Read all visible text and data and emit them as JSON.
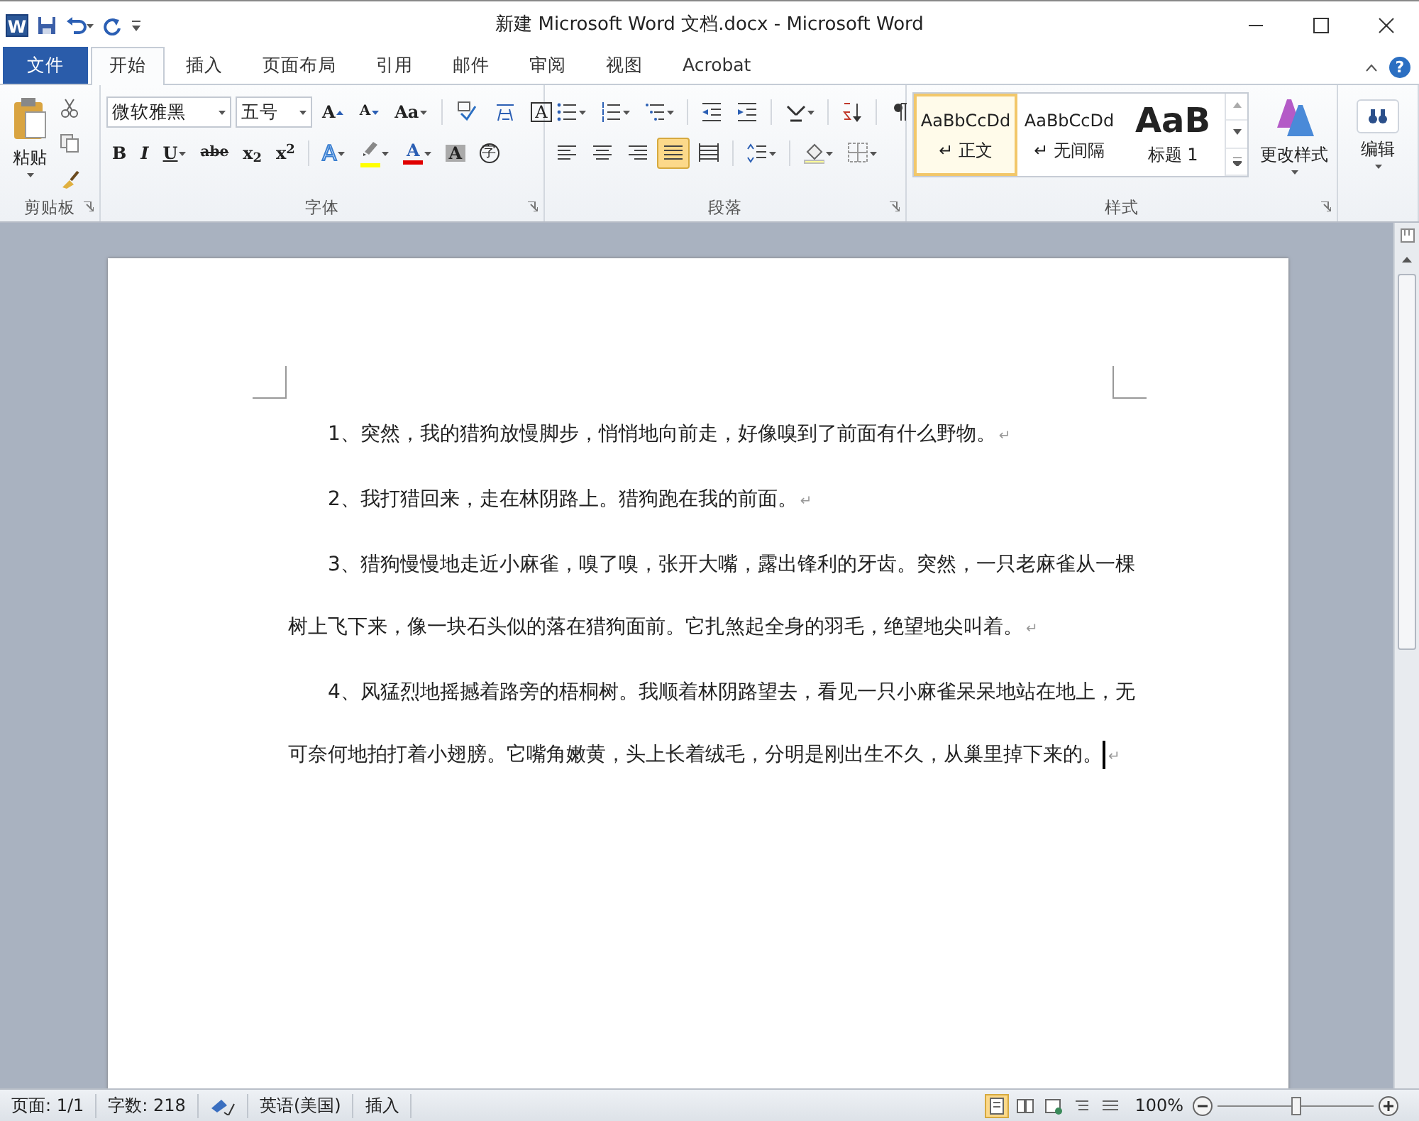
{
  "window": {
    "title": "新建 Microsoft Word 文档.docx - Microsoft Word",
    "logo_letter": "W"
  },
  "tabs": [
    {
      "label": "文件",
      "kind": "file",
      "selected": false
    },
    {
      "label": "开始",
      "kind": "tab",
      "selected": true
    },
    {
      "label": "插入",
      "kind": "tab",
      "selected": false
    },
    {
      "label": "页面布局",
      "kind": "tab",
      "selected": false
    },
    {
      "label": "引用",
      "kind": "tab",
      "selected": false
    },
    {
      "label": "邮件",
      "kind": "tab",
      "selected": false
    },
    {
      "label": "审阅",
      "kind": "tab",
      "selected": false
    },
    {
      "label": "视图",
      "kind": "tab",
      "selected": false
    },
    {
      "label": "Acrobat",
      "kind": "tab",
      "selected": false
    }
  ],
  "help": "?",
  "ribbon": {
    "clipboard": {
      "label": "剪贴板",
      "paste": "粘贴"
    },
    "font": {
      "label": "字体",
      "font_name": "微软雅黑",
      "font_size": "五号",
      "row1": [
        {
          "kind": "grow",
          "text": "A"
        },
        {
          "kind": "shrink",
          "text": "A"
        },
        {
          "kind": "case",
          "text": "Aa",
          "dropdown": true
        },
        {
          "kind": "sep"
        },
        {
          "kind": "pinyin"
        },
        {
          "kind": "phonetic"
        },
        {
          "kind": "border",
          "text": "A"
        }
      ],
      "row2": [
        {
          "kind": "bold",
          "text": "B"
        },
        {
          "kind": "italic",
          "text": "I"
        },
        {
          "kind": "underline",
          "text": "U",
          "dropdown": true
        },
        {
          "kind": "strike",
          "text": "abe"
        },
        {
          "kind": "subscript",
          "text": "x$_{2}$"
        },
        {
          "kind": "superscript",
          "text": "x$^{2}$"
        },
        {
          "kind": "sep"
        },
        {
          "kind": "effect",
          "text": "A",
          "dropdown": true
        },
        {
          "kind": "highlight",
          "color": "#ffff00",
          "dropdown": true
        },
        {
          "kind": "font-color",
          "text": "A",
          "color": "#e00000",
          "dropdown": true
        },
        {
          "kind": "shading",
          "text": "A"
        },
        {
          "kind": "enclosed",
          "text": "字"
        }
      ]
    },
    "paragraph": {
      "label": "段落",
      "row1": [
        {
          "kind": "bullets",
          "dropdown": true
        },
        {
          "kind": "numbering",
          "dropdown": true
        },
        {
          "kind": "multilevel",
          "dropdown": true
        },
        {
          "kind": "sep"
        },
        {
          "kind": "outdent"
        },
        {
          "kind": "indent"
        },
        {
          "kind": "sep"
        },
        {
          "kind": "asian-layout",
          "dropdown": true
        },
        {
          "kind": "sep"
        },
        {
          "kind": "sort"
        },
        {
          "kind": "sep"
        },
        {
          "kind": "marks"
        }
      ],
      "row2": [
        {
          "kind": "align-left",
          "selected": false
        },
        {
          "kind": "align-center",
          "selected": false
        },
        {
          "kind": "align-right",
          "selected": false
        },
        {
          "kind": "justify",
          "selected": true
        },
        {
          "kind": "distributed",
          "selected": false
        },
        {
          "kind": "sep"
        },
        {
          "kind": "line-spacing",
          "dropdown": true
        },
        {
          "kind": "sep"
        },
        {
          "kind": "fill",
          "dropdown": true
        },
        {
          "kind": "borders",
          "dropdown": true
        }
      ]
    },
    "styles": {
      "label": "样式",
      "change_styles": "更改样式",
      "items": [
        {
          "preview": "AaBbCcDd",
          "name": "正文",
          "mark": "↵",
          "kind": "body",
          "selected": true
        },
        {
          "preview": "AaBbCcDd",
          "name": "无间隔",
          "mark": "↵",
          "kind": "body",
          "selected": false
        },
        {
          "preview": "AaB",
          "name": "标题 1",
          "kind": "heading",
          "selected": false
        }
      ]
    },
    "editing": {
      "label": "编辑"
    }
  },
  "document": {
    "paragraphs": [
      {
        "text": "1、突然，我的猎狗放慢脚步，悄悄地向前走，好像嗅到了前面有什么野物。",
        "end_mark": "↵",
        "cursor": false
      },
      {
        "text": "2、我打猎回来，走在林阴路上。猎狗跑在我的前面。",
        "end_mark": "↵",
        "cursor": false
      },
      {
        "text": "3、猎狗慢慢地走近小麻雀，嗅了嗅，张开大嘴，露出锋利的牙齿。突然，一只老麻雀从一棵树上飞下来，像一块石头似的落在猎狗面前。它扎煞起全身的羽毛，绝望地尖叫着。",
        "end_mark": "↵",
        "cursor": false
      },
      {
        "text": "4、风猛烈地摇撼着路旁的梧桐树。我顺着林阴路望去，看见一只小麻雀呆呆地站在地上，无可奈何地拍打着小翅膀。它嘴角嫩黄，头上长着绒毛，分明是刚出生不久，从巢里掉下来的。",
        "end_mark": "↵",
        "cursor": true
      }
    ]
  },
  "status_bar": {
    "page": "页面: 1/1",
    "words": "字数: 218",
    "language": "英语(美国)",
    "mode": "插入",
    "views": [
      {
        "kind": "print",
        "selected": true
      },
      {
        "kind": "reading",
        "selected": false
      },
      {
        "kind": "web",
        "selected": false
      },
      {
        "kind": "outline",
        "selected": false
      },
      {
        "kind": "draft",
        "selected": false
      }
    ],
    "zoom": "100%",
    "zoom_level": {
      "level": 0.5
    }
  }
}
